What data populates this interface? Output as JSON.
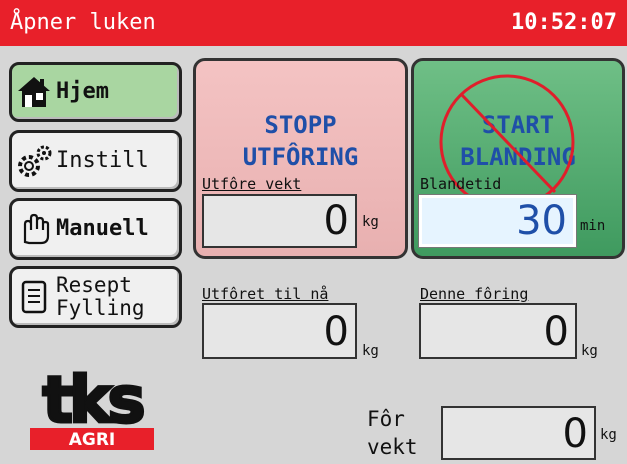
{
  "titlebar": {
    "title": "Åpner luken",
    "clock": "10:52:07",
    "color": "#e8202a"
  },
  "nav": {
    "home": "Hjem",
    "settings": "Instill",
    "manual": "Manuell",
    "recipe_line1": "Resept",
    "recipe_line2": "Fylling"
  },
  "stop_panel": {
    "line1": "STOPP",
    "line2": "UTFÔRING",
    "field_label": "Utfôre vekt",
    "value": "0",
    "unit": "kg",
    "color": "#f4c3c3"
  },
  "start_panel": {
    "line1": "START",
    "line2": "BLANDING",
    "field_label": "Blandetid",
    "value": "30",
    "unit": "min",
    "disabled_mark": "prohibited-icon",
    "color": "#4fa96b"
  },
  "fed_so_far": {
    "label": "Utfôret til nå",
    "value": "0",
    "unit": "kg"
  },
  "this_feeding": {
    "label": "Denne fôring",
    "value": "0",
    "unit": "kg"
  },
  "feed_weight": {
    "label_line1": "Fôr",
    "label_line2": "vekt",
    "value": "0",
    "unit": "kg"
  },
  "logo": {
    "brand": "tks",
    "sub": "AGRI"
  }
}
